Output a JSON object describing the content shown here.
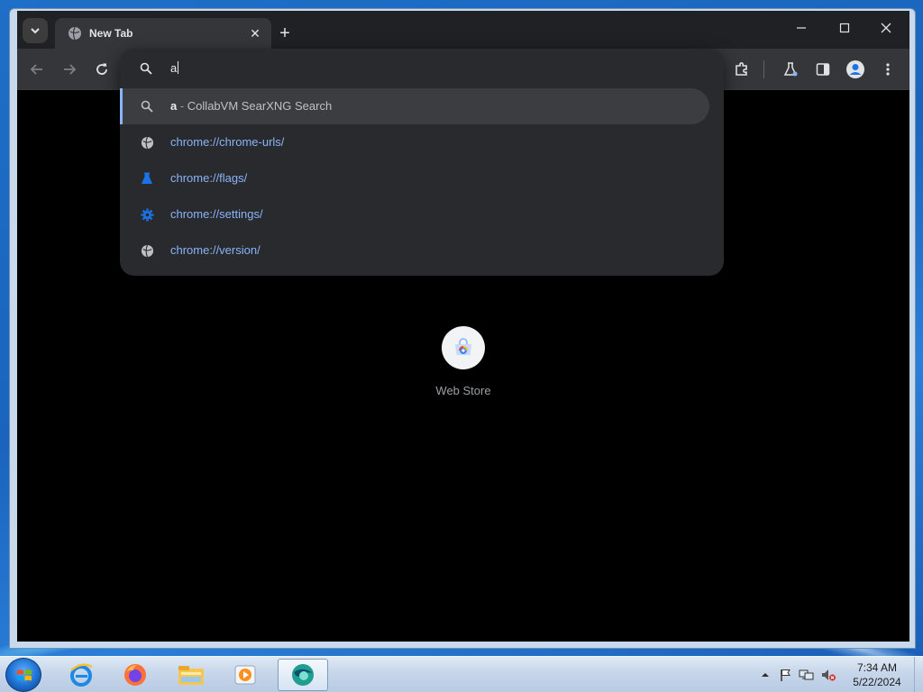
{
  "browser": {
    "tab": {
      "title": "New Tab",
      "close_glyph": "✕"
    },
    "new_tab_glyph": "+",
    "window_controls": {
      "minimize": "—",
      "maximize": "☐",
      "close": "✕"
    }
  },
  "omnibox": {
    "query": "a",
    "suggestions": [
      {
        "query": "a",
        "separator": " - ",
        "text": "CollabVM SearXNG Search",
        "icon": "search-icon",
        "selected": true
      },
      {
        "text": "chrome://chrome-urls/",
        "icon": "globe-icon"
      },
      {
        "text": "chrome://flags/",
        "icon": "flask-icon"
      },
      {
        "text": "chrome://settings/",
        "icon": "gear-icon"
      },
      {
        "text": "chrome://version/",
        "icon": "globe-icon"
      }
    ]
  },
  "new_tab_page": {
    "shortcuts": [
      {
        "label": "Web Store",
        "icon": "web-store-icon"
      }
    ]
  },
  "taskbar": {
    "apps": [
      "internet-explorer-icon",
      "firefox-icon",
      "file-explorer-icon",
      "media-player-icon",
      "browser-icon"
    ],
    "clock": {
      "time": "7:34 AM",
      "date": "5/22/2024"
    }
  },
  "colors": {
    "accent": "#8ab4f8",
    "toolbar": "#35363a",
    "titlebar": "#202124",
    "dropdown": "#282a2d"
  }
}
